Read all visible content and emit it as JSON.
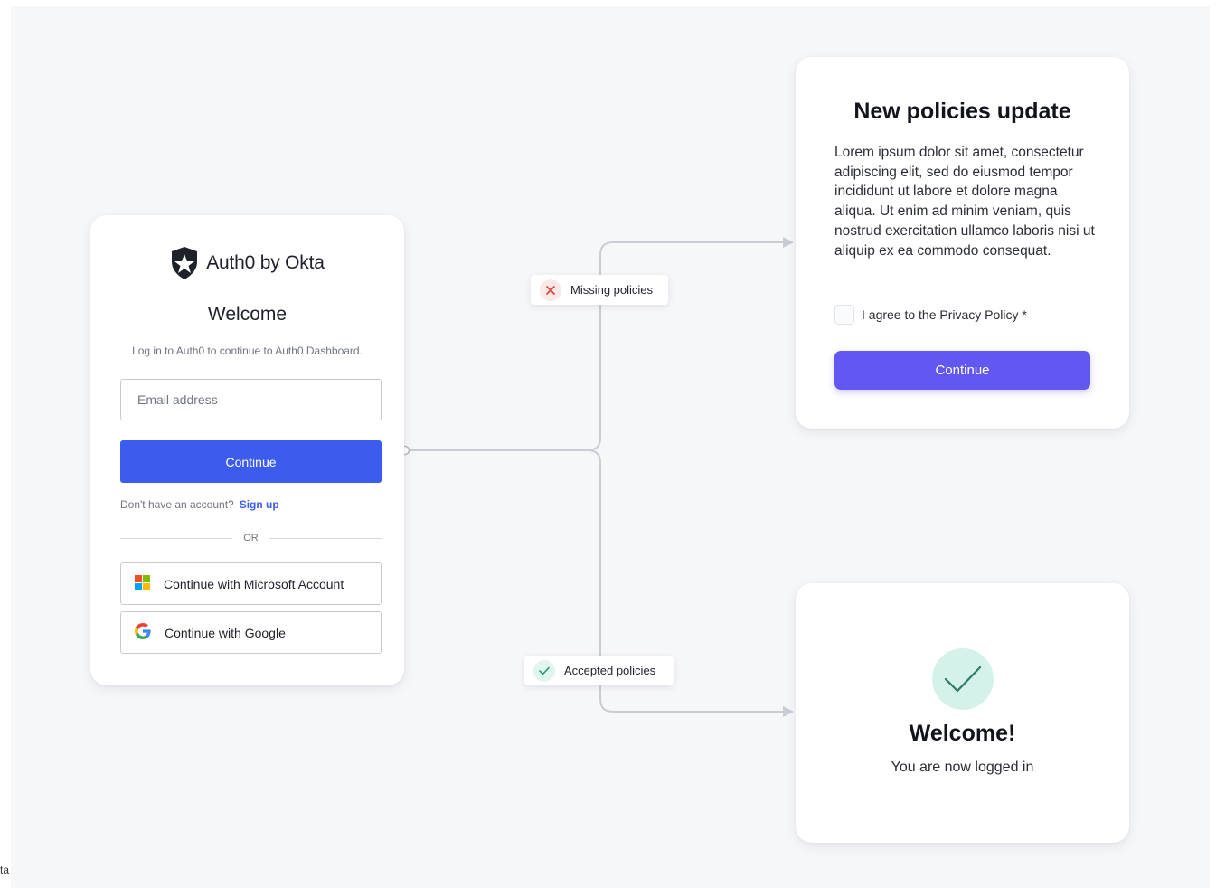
{
  "login_card": {
    "brand_name": "Auth0 by Okta",
    "logo_icon": "auth0-shield-icon",
    "welcome": "Welcome",
    "subtitle": "Log in to Auth0 to continue to Auth0 Dashboard.",
    "email_placeholder": "Email address",
    "continue_label": "Continue",
    "signup_prompt": "Don't have an account?",
    "signup_link": "Sign up",
    "or_label": "OR",
    "microsoft_button": "Continue with Microsoft Account",
    "google_button": "Continue with Google",
    "colors": {
      "primary": "#3c5cf0"
    }
  },
  "flow": {
    "missing_label": "Missing policies",
    "missing_icon": "x-icon",
    "accepted_label": "Accepted policies",
    "accepted_icon": "check-icon"
  },
  "policies_card": {
    "title": "New policies update",
    "body": "Lorem ipsum dolor sit amet, consectetur adipiscing elit, sed do eiusmod tempor incididunt ut labore et dolore magna aliqua. Ut enim ad minim veniam, quis nostrud exercitation ullamco laboris nisi ut aliquip ex ea commodo consequat.",
    "agree_label": "I agree to the Privacy Policy *",
    "agree_checked": false,
    "continue_label": "Continue",
    "colors": {
      "primary": "#6357f2"
    }
  },
  "success_card": {
    "icon": "checkmark-icon",
    "title": "Welcome!",
    "subtitle": "You are now logged in"
  },
  "corner_text": "ta"
}
